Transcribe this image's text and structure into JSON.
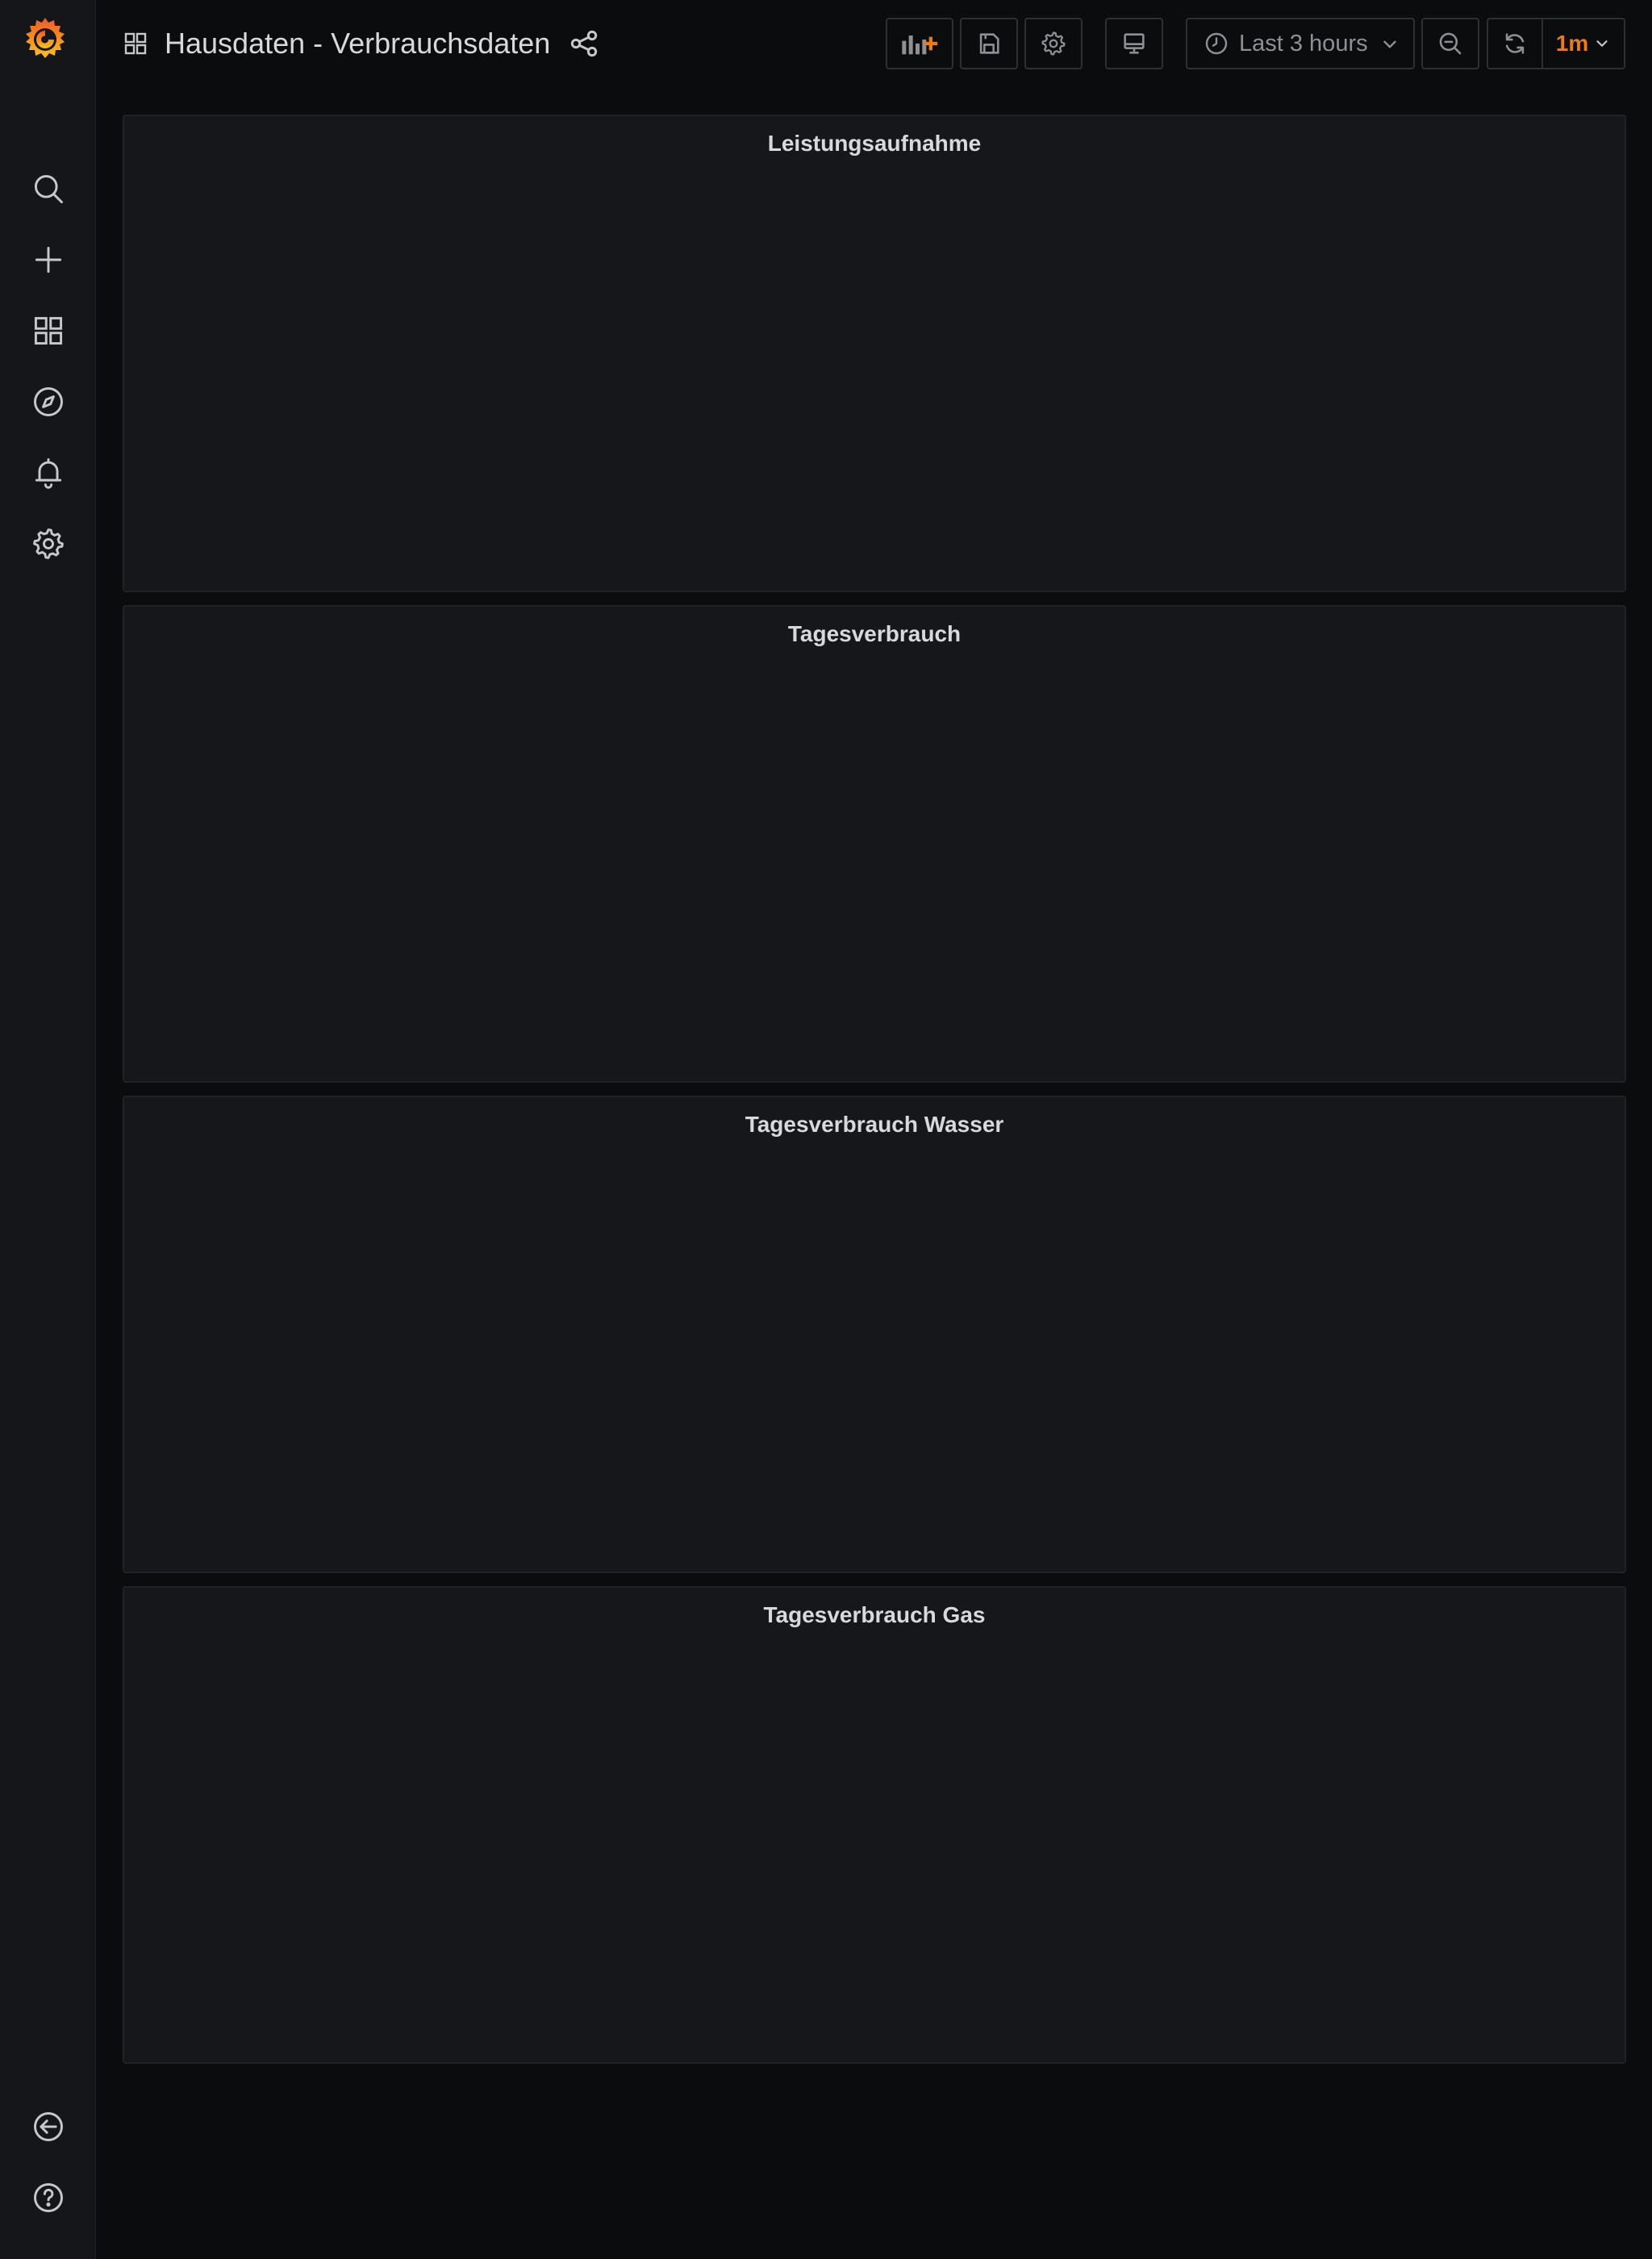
{
  "header": {
    "title": "Hausdaten - Verbrauchsdaten"
  },
  "toolbar": {
    "time_range_label": "Last 3 hours",
    "refresh_interval_label": "1m"
  },
  "panels": [
    {
      "title": "Leistungsaufnahme"
    },
    {
      "title": "Tagesverbrauch"
    },
    {
      "title": "Tagesverbrauch Wasser"
    },
    {
      "title": "Tagesverbrauch Gas"
    }
  ],
  "colors": {
    "accent": "#eb7b18",
    "background": "#0b0c0e",
    "panel": "#16171b",
    "sidebar": "#141619"
  },
  "icons": {
    "sidebar": [
      "search-icon",
      "plus-icon",
      "dashboards-icon",
      "explore-icon",
      "alerting-icon",
      "settings-icon",
      "sign-out-icon",
      "help-icon"
    ],
    "toolbar": [
      "add-panel-icon",
      "save-icon",
      "settings-icon",
      "tv-mode-icon",
      "clock-icon",
      "zoom-out-icon",
      "refresh-icon"
    ]
  }
}
